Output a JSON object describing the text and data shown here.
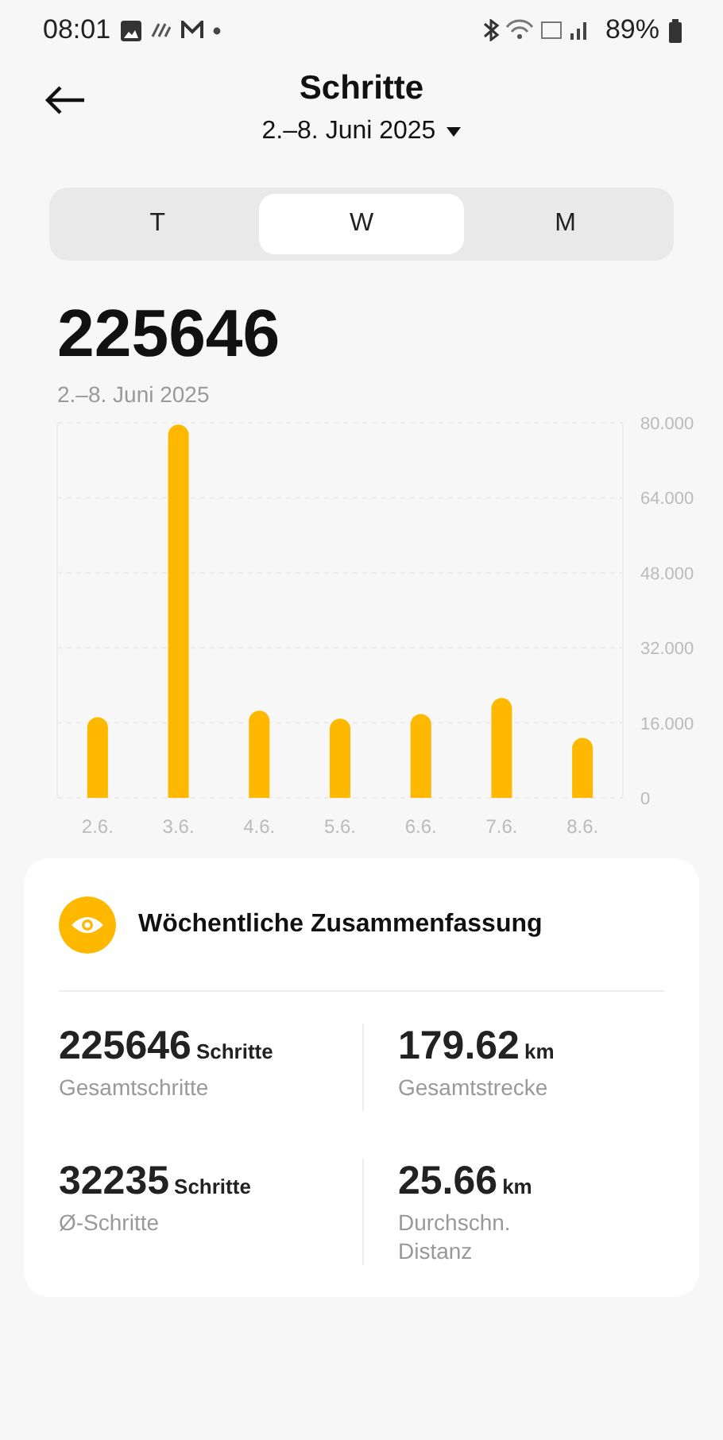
{
  "status_bar": {
    "time": "08:01",
    "battery": "89%"
  },
  "header": {
    "title": "Schritte",
    "date_range": "2.–8. Juni 2025"
  },
  "tabs": [
    {
      "label": "T",
      "selected": false
    },
    {
      "label": "W",
      "selected": true
    },
    {
      "label": "M",
      "selected": false
    }
  ],
  "total": {
    "value": "225646",
    "range": "2.–8. Juni 2025"
  },
  "chart_data": {
    "type": "bar",
    "categories": [
      "2.6.",
      "3.6.",
      "4.6.",
      "5.6.",
      "6.6.",
      "7.6.",
      "8.6."
    ],
    "series": [
      {
        "color": "#ffb800",
        "values": [
          17.2,
          79.6,
          18.6,
          16.9,
          17.9,
          21.3,
          12.8
        ]
      }
    ],
    "ylim": [
      0,
      80
    ],
    "grid": true,
    "yticks": [
      {
        "value": 0,
        "label": "0"
      },
      {
        "value": 16,
        "label": "16.000"
      },
      {
        "value": 32,
        "label": "32.000"
      },
      {
        "value": 48,
        "label": "48.000"
      },
      {
        "value": 64,
        "label": "64.000"
      },
      {
        "value": 80,
        "label": "80.000"
      }
    ]
  },
  "summary": {
    "title": "Wöchentliche Zusammenfassung",
    "stats": [
      {
        "value": "225646",
        "unit": "Schritte",
        "label": "Gesamtschritte"
      },
      {
        "value": "179.62",
        "unit": "km",
        "label": "Gesamtstrecke"
      },
      {
        "value": "32235",
        "unit": "Schritte",
        "label": "Ø-Schritte"
      },
      {
        "value": "25.66",
        "unit": "km",
        "label": "Durchschn. Distanz"
      }
    ]
  }
}
